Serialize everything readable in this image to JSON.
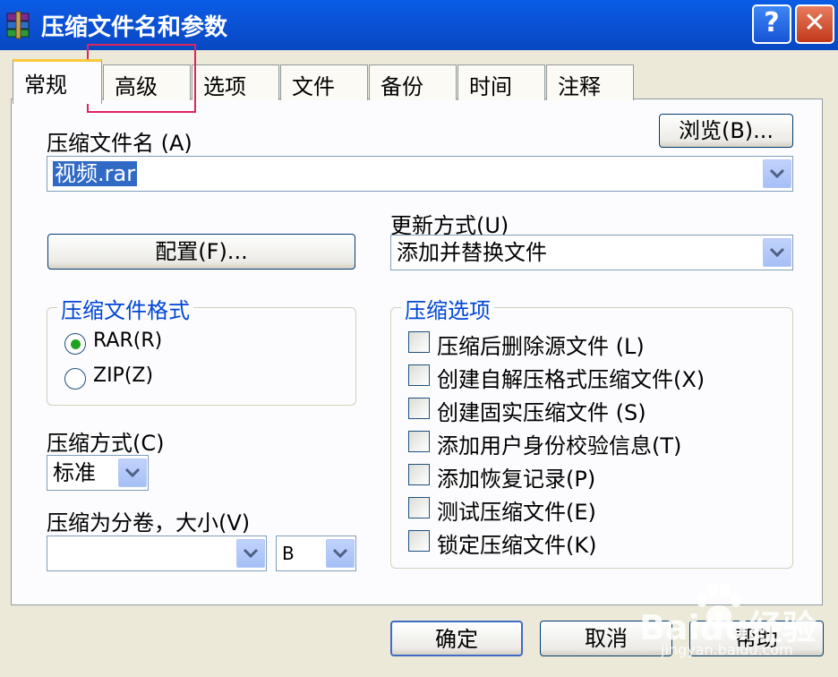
{
  "window": {
    "title": "压缩文件名和参数",
    "help_glyph": "?",
    "close_glyph": "✕"
  },
  "tabs": [
    {
      "label": "常规",
      "active": true
    },
    {
      "label": "高级"
    },
    {
      "label": "选项"
    },
    {
      "label": "文件"
    },
    {
      "label": "备份"
    },
    {
      "label": "时间"
    },
    {
      "label": "注释"
    }
  ],
  "general": {
    "archive_name_label": "压缩文件名 (A)",
    "archive_name_value": "视频.rar",
    "browse_button": "浏览(B)...",
    "profile_button": "配置(F)...",
    "update_mode_label": "更新方式(U)",
    "update_mode_value": "添加并替换文件",
    "format_group": "压缩文件格式",
    "format_options": [
      {
        "label": "RAR(R)",
        "selected": true
      },
      {
        "label": "ZIP(Z)",
        "selected": false
      }
    ],
    "method_label": "压缩方式(C)",
    "method_value": "标准",
    "volume_label": "压缩为分卷，大小(V)",
    "volume_value": "",
    "volume_unit": "B",
    "options_group": "压缩选项",
    "options": [
      {
        "label": "压缩后删除源文件 (L)",
        "checked": false
      },
      {
        "label": "创建自解压格式压缩文件(X)",
        "checked": false
      },
      {
        "label": "创建固实压缩文件 (S)",
        "checked": false
      },
      {
        "label": "添加用户身份校验信息(T)",
        "checked": false
      },
      {
        "label": "添加恢复记录(P)",
        "checked": false
      },
      {
        "label": "测试压缩文件(E)",
        "checked": false
      },
      {
        "label": "锁定压缩文件(K)",
        "checked": false
      }
    ]
  },
  "footer": {
    "ok": "确定",
    "cancel": "取消",
    "help": "帮助"
  },
  "watermark": {
    "brand": "Baidu经验",
    "url": "jingyan.baidu.com"
  },
  "colors": {
    "titlebar": "#0A53D8",
    "group_label": "#0046D5",
    "highlight": "#316AC5",
    "annotation_box": "#E0245E"
  }
}
